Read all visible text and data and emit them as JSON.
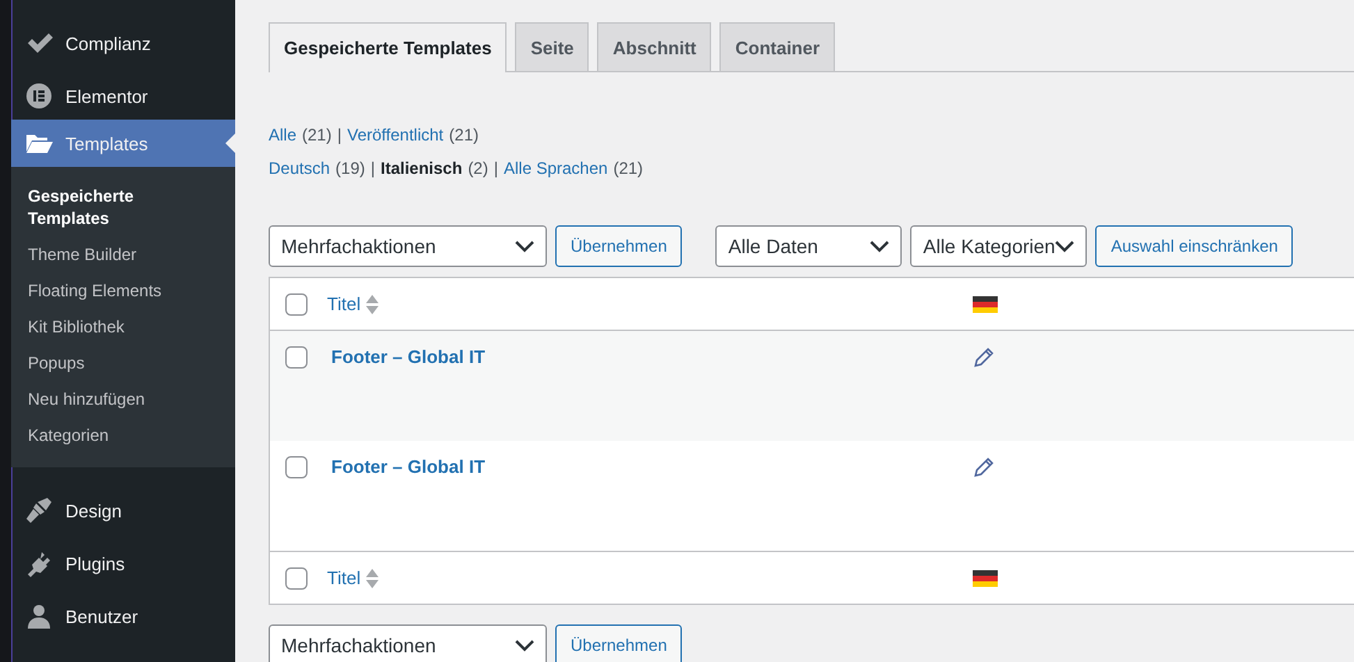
{
  "sidebar": {
    "items": [
      {
        "label": "Complianz",
        "selected": false
      },
      {
        "label": "Elementor",
        "selected": false
      },
      {
        "label": "Templates",
        "selected": true,
        "children": [
          {
            "label": "Gespeicherte Templates",
            "selected": true
          },
          {
            "label": "Theme Builder",
            "selected": false
          },
          {
            "label": "Floating Elements",
            "selected": false
          },
          {
            "label": "Kit Bibliothek",
            "selected": false
          },
          {
            "label": "Popups",
            "selected": false
          },
          {
            "label": "Neu hinzufügen",
            "selected": false
          },
          {
            "label": "Kategorien",
            "selected": false
          }
        ]
      },
      {
        "label": "Design",
        "selected": false
      },
      {
        "label": "Plugins",
        "selected": false
      },
      {
        "label": "Benutzer",
        "selected": false
      }
    ]
  },
  "tabs": [
    {
      "label": "Gespeicherte Templates",
      "selected": true
    },
    {
      "label": "Seite",
      "selected": false
    },
    {
      "label": "Abschnitt",
      "selected": false
    },
    {
      "label": "Container",
      "selected": false
    }
  ],
  "views": [
    [
      {
        "label": "Alle",
        "count": "(21)",
        "selected": false,
        "separator": "|"
      },
      {
        "label": "Veröffentlicht",
        "count": "(21)",
        "selected": false
      }
    ],
    [
      {
        "label": "Deutsch",
        "count": "(19)",
        "selected": false,
        "separator": "|"
      },
      {
        "label": "Italienisch",
        "count": "(2)",
        "selected": true,
        "separator": "|"
      },
      {
        "label": "Alle Sprachen",
        "count": "(21)",
        "selected": false
      }
    ]
  ],
  "top_toolbar": {
    "bulk_action": "Mehrfachaktionen",
    "apply": "Übernehmen",
    "date_filter": "Alle Daten",
    "category_filter": "Alle Kategorien",
    "filter_button": "Auswahl einschränken"
  },
  "table": {
    "header": {
      "checked": false,
      "columns": [
        {
          "label": "Titel"
        },
        {
          "kind": "flag"
        }
      ]
    },
    "footer": {
      "checked": false,
      "columns": [
        {
          "label": "Titel"
        },
        {
          "kind": "flag"
        }
      ]
    },
    "rows": [
      {
        "title": "Footer – Global IT",
        "checked": false
      },
      {
        "title": "Footer – Global IT",
        "checked": false
      }
    ]
  },
  "bottom_toolbar": {
    "bulk_action": "Mehrfachaktionen",
    "apply": "Übernehmen"
  }
}
